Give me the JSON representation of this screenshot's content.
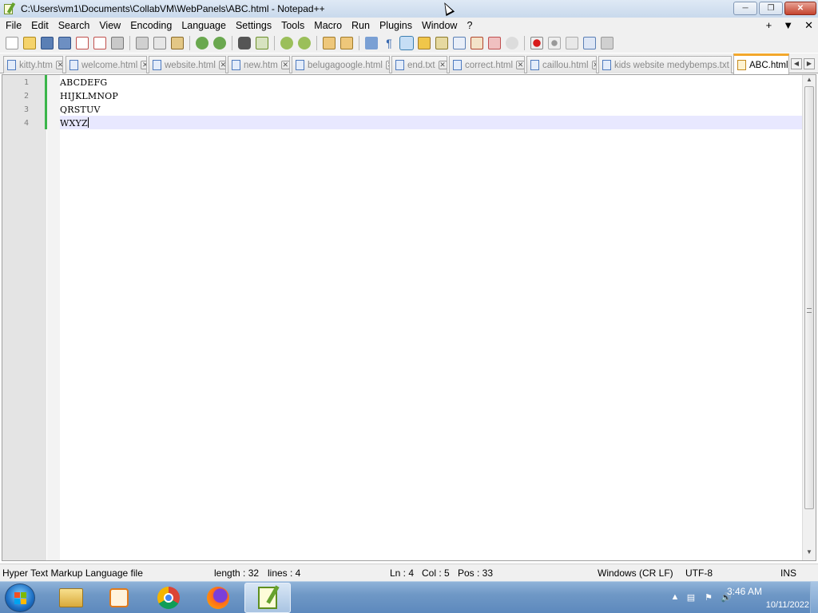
{
  "window": {
    "title": "C:\\Users\\vm1\\Documents\\CollabVM\\WebPanels\\ABC.html - Notepad++",
    "controls": [
      "minimize",
      "maximize",
      "close"
    ]
  },
  "menu": {
    "items": [
      "File",
      "Edit",
      "Search",
      "View",
      "Encoding",
      "Language",
      "Settings",
      "Tools",
      "Macro",
      "Run",
      "Plugins",
      "Window",
      "?"
    ],
    "right": [
      "+",
      "▼",
      "✕"
    ]
  },
  "tabs": [
    {
      "label": "kitty.htm"
    },
    {
      "label": "welcome.html"
    },
    {
      "label": "website.html"
    },
    {
      "label": "new.htm"
    },
    {
      "label": "belugagoogle.html"
    },
    {
      "label": "end.txt"
    },
    {
      "label": "correct.html"
    },
    {
      "label": "caillou.html"
    },
    {
      "label": "kids website medybemps.txt"
    },
    {
      "label": "ABC.html"
    }
  ],
  "editor": {
    "lines": [
      {
        "num": "1",
        "text": "ABCDEFG"
      },
      {
        "num": "2",
        "text": "HIJKLMNOP"
      },
      {
        "num": "3",
        "text": "QRSTUV"
      },
      {
        "num": "4",
        "text": "WXYZ"
      }
    ]
  },
  "status": {
    "filetype": "Hyper Text Markup Language file",
    "length": "length : 32",
    "lines": "lines : 4",
    "ln": "Ln : 4",
    "col": "Col : 5",
    "pos": "Pos : 33",
    "eol": "Windows (CR LF)",
    "encoding": "UTF-8",
    "mode": "INS"
  },
  "taskbar": {
    "apps": [
      "file-explorer",
      "media-player",
      "chrome",
      "firefox",
      "notepad-plus-plus"
    ],
    "time": "3:46 AM",
    "date": "10/11/2022"
  },
  "colors": {
    "active_tab_accent": "#f3a72b",
    "current_line": "#e8e8ff",
    "change_bar": "#3ab54a"
  }
}
